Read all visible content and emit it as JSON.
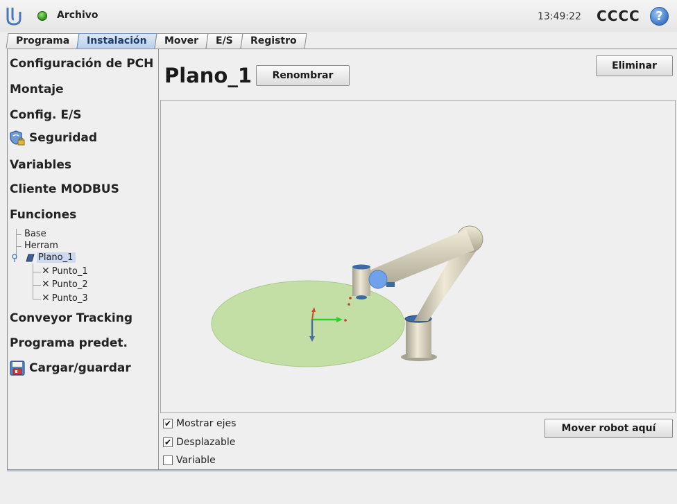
{
  "topbar": {
    "file_menu": "Archivo",
    "time": "13:49:22",
    "robot_name": "CCCC",
    "help_glyph": "?",
    "status_color": "#3aa51d"
  },
  "tabs": [
    {
      "label": "Programa"
    },
    {
      "label": "Instalación",
      "active": true
    },
    {
      "label": "Mover"
    },
    {
      "label": "E/S"
    },
    {
      "label": "Registro"
    }
  ],
  "sidebar": {
    "items": [
      {
        "label": "Configuración de PCH"
      },
      {
        "label": "Montaje"
      },
      {
        "label": "Config. E/S"
      },
      {
        "label": "Seguridad",
        "icon": "shield-lock-icon"
      },
      {
        "label": "Variables"
      },
      {
        "label": "Cliente MODBUS"
      },
      {
        "label": "Funciones"
      },
      {
        "label": "Conveyor Tracking"
      },
      {
        "label": "Programa predet."
      },
      {
        "label": "Cargar/guardar",
        "icon": "floppy-disk-icon"
      }
    ],
    "tree": {
      "base": "Base",
      "tool": "Herram",
      "plane": "Plano_1",
      "points": [
        "Punto_1",
        "Punto_2",
        "Punto_3"
      ]
    }
  },
  "main": {
    "title": "Plano_1",
    "rename_label": "Renombrar",
    "delete_label": "Eliminar",
    "move_here_label": "Mover robot aquí",
    "checkboxes": [
      {
        "label": "Mostrar ejes",
        "checked": true
      },
      {
        "label": "Desplazable",
        "checked": true
      },
      {
        "label": "Variable",
        "checked": false
      }
    ],
    "check_glyph": "✔",
    "accent_color": "#5d86c2",
    "plane_color": "#c3dfa6"
  }
}
